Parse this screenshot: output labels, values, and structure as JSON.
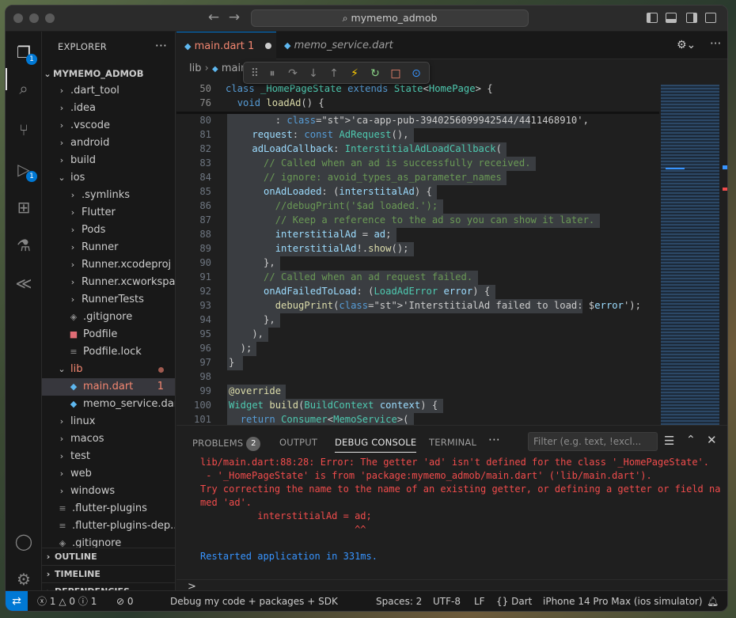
{
  "window": {
    "search_label": "mymemo_admob"
  },
  "activity": {
    "explorer_badge": "1",
    "debug_badge": "1"
  },
  "explorer": {
    "title": "EXPLORER",
    "root": "MYMEMO_ADMOB",
    "items": [
      {
        "label": ".dart_tool",
        "kind": "folder"
      },
      {
        "label": ".idea",
        "kind": "folder"
      },
      {
        "label": ".vscode",
        "kind": "folder"
      },
      {
        "label": "android",
        "kind": "folder"
      },
      {
        "label": "build",
        "kind": "folder"
      },
      {
        "label": "ios",
        "kind": "folder-open"
      },
      {
        "label": ".symlinks",
        "kind": "folder"
      },
      {
        "label": "Flutter",
        "kind": "folder"
      },
      {
        "label": "Pods",
        "kind": "folder"
      },
      {
        "label": "Runner",
        "kind": "folder"
      },
      {
        "label": "Runner.xcodeproj",
        "kind": "folder"
      },
      {
        "label": "Runner.xcworkspace",
        "kind": "folder"
      },
      {
        "label": "RunnerTests",
        "kind": "folder"
      },
      {
        "label": ".gitignore",
        "kind": "file"
      },
      {
        "label": "Podfile",
        "kind": "file"
      },
      {
        "label": "Podfile.lock",
        "kind": "file"
      },
      {
        "label": "lib",
        "kind": "folder-open"
      },
      {
        "label": "main.dart",
        "kind": "dart",
        "count": "1"
      },
      {
        "label": "memo_service.dart",
        "kind": "dart"
      },
      {
        "label": "linux",
        "kind": "folder"
      },
      {
        "label": "macos",
        "kind": "folder"
      },
      {
        "label": "test",
        "kind": "folder"
      },
      {
        "label": "web",
        "kind": "folder"
      },
      {
        "label": "windows",
        "kind": "folder"
      },
      {
        "label": ".flutter-plugins",
        "kind": "file"
      },
      {
        "label": ".flutter-plugins-dep...",
        "kind": "file"
      },
      {
        "label": ".gitignore",
        "kind": "file"
      }
    ],
    "sections": [
      "OUTLINE",
      "TIMELINE",
      "DEPENDENCIES"
    ]
  },
  "tabs": [
    {
      "label": "main.dart",
      "count": "1"
    },
    {
      "label": "memo_service.dart"
    }
  ],
  "breadcrumb": {
    "part1": "lib",
    "part2": "main.dart",
    "part3": "..."
  },
  "editor": {
    "sticky": [
      {
        "ln": "50",
        "text": "class _HomePageState extends State<HomePage> {"
      },
      {
        "ln": "76",
        "text": "  void loadAd() {"
      }
    ],
    "lines": [
      {
        "ln": "80",
        "text": "        : 'ca-app-pub-3940256099942544/4411468910',"
      },
      {
        "ln": "81",
        "text": "    request: const AdRequest(),"
      },
      {
        "ln": "82",
        "text": "    adLoadCallback: InterstitialAdLoadCallback("
      },
      {
        "ln": "83",
        "text": "      // Called when an ad is successfully received."
      },
      {
        "ln": "84",
        "text": "      // ignore: avoid_types_as_parameter_names"
      },
      {
        "ln": "85",
        "text": "      onAdLoaded: (interstitalAd) {"
      },
      {
        "ln": "86",
        "text": "        //debugPrint('$ad loaded.');"
      },
      {
        "ln": "87",
        "text": "        // Keep a reference to the ad so you can show it later."
      },
      {
        "ln": "88",
        "text": "        interstitialAd = ad;"
      },
      {
        "ln": "89",
        "text": "        interstitialAd!.show();"
      },
      {
        "ln": "90",
        "text": "      },"
      },
      {
        "ln": "91",
        "text": "      // Called when an ad request failed."
      },
      {
        "ln": "92",
        "text": "      onAdFailedToLoad: (LoadAdError error) {"
      },
      {
        "ln": "93",
        "text": "        debugPrint('InterstitialAd failed to load: $error');"
      },
      {
        "ln": "94",
        "text": "      },"
      },
      {
        "ln": "95",
        "text": "    ),"
      },
      {
        "ln": "96",
        "text": "  );"
      },
      {
        "ln": "97",
        "text": "}"
      },
      {
        "ln": "98",
        "text": ""
      },
      {
        "ln": "99",
        "text": "@override"
      },
      {
        "ln": "100",
        "text": "Widget build(BuildContext context) {"
      },
      {
        "ln": "101",
        "text": "  return Consumer<MemoService>("
      }
    ]
  },
  "panel": {
    "tabs": [
      "PROBLEMS",
      "OUTPUT",
      "DEBUG CONSOLE",
      "TERMINAL"
    ],
    "problems_count": "2",
    "more": "···",
    "filter_placeholder": "Filter (e.g. text, !excl...",
    "output": [
      "lib/main.dart:88:28: Error: The getter 'ad' isn't defined for the class '_HomePageState'.",
      " - '_HomePageState' is from 'package:mymemo_admob/main.dart' ('lib/main.dart').",
      "Try correcting the name to the name of an existing getter, or defining a getter or field na",
      "med 'ad'.",
      "          interstitialAd = ad;",
      "                           ^^",
      "Restarted application in 331ms."
    ],
    "prompt": ">"
  },
  "status": {
    "errors": "1",
    "warnings": "0",
    "info": "1",
    "ports": "0",
    "debug_mode": "Debug my code + packages + SDK",
    "spaces": "Spaces: 2",
    "encoding": "UTF-8",
    "eol": "LF",
    "language": "Dart",
    "device": "iPhone 14 Pro Max (ios simulator)"
  },
  "colors": {
    "accent": "#0078d4",
    "error": "#f14c4c",
    "info": "#3794ff"
  }
}
